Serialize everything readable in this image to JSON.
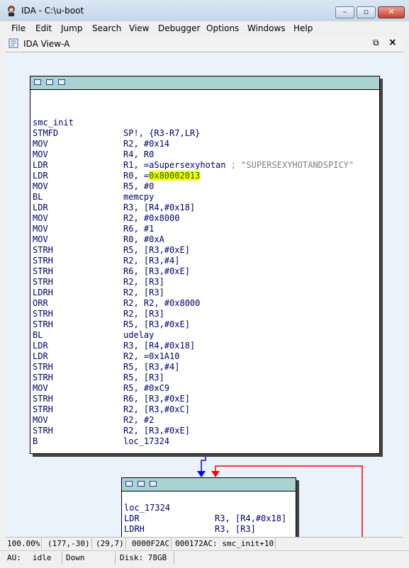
{
  "window": {
    "title": "IDA - C:\\u-boot",
    "min_label": "–",
    "max_label": "▫",
    "close_label": "✕"
  },
  "menu": [
    "File",
    "Edit",
    "Jump",
    "Search",
    "View",
    "Debugger",
    "Options",
    "Windows",
    "Help"
  ],
  "view_tab": {
    "title": "IDA View-A",
    "float_glyph": "⧉",
    "close_glyph": "×"
  },
  "graph": {
    "node1": {
      "label": "smc_init",
      "lines": [
        {
          "m": "STMFD",
          "o": "SP!, {R3-R7,LR}"
        },
        {
          "m": "MOV",
          "o": "R2, #0x14"
        },
        {
          "m": "MOV",
          "o": "R4, R0"
        },
        {
          "m": "LDR",
          "o": "R1, =aSupersexyhotan",
          "c": " ; \"SUPERSEXYHOTANDSPICY\""
        },
        {
          "m": "LDR",
          "o": "R0, =",
          "h": "0x80002013"
        },
        {
          "m": "MOV",
          "o": "R5, #0"
        },
        {
          "m": "BL",
          "o": "memcpy"
        },
        {
          "m": "LDR",
          "o": "R3, [R4,#0x18]"
        },
        {
          "m": "MOV",
          "o": "R2, #0x8000"
        },
        {
          "m": "MOV",
          "o": "R6, #1"
        },
        {
          "m": "MOV",
          "o": "R0, #0xA"
        },
        {
          "m": "STRH",
          "o": "R5, [R3,#0xE]"
        },
        {
          "m": "STRH",
          "o": "R2, [R3,#4]"
        },
        {
          "m": "STRH",
          "o": "R6, [R3,#0xE]"
        },
        {
          "m": "STRH",
          "o": "R2, [R3]"
        },
        {
          "m": "LDRH",
          "o": "R2, [R3]"
        },
        {
          "m": "ORR",
          "o": "R2, R2, #0x8000"
        },
        {
          "m": "STRH",
          "o": "R2, [R3]"
        },
        {
          "m": "STRH",
          "o": "R5, [R3,#0xE]"
        },
        {
          "m": "BL",
          "o": "udelay"
        },
        {
          "m": "LDR",
          "o": "R3, [R4,#0x18]"
        },
        {
          "m": "LDR",
          "o": "R2, =0x1A10"
        },
        {
          "m": "STRH",
          "o": "R5, [R3,#4]"
        },
        {
          "m": "STRH",
          "o": "R5, [R3]"
        },
        {
          "m": "MOV",
          "o": "R5, #0xC9"
        },
        {
          "m": "STRH",
          "o": "R6, [R3,#0xE]"
        },
        {
          "m": "STRH",
          "o": "R2, [R3,#0xC]"
        },
        {
          "m": "MOV",
          "o": "R2, #2"
        },
        {
          "m": "STRH",
          "o": "R2, [R3,#0xE]"
        },
        {
          "m": "B",
          "o": "loc_17324"
        }
      ]
    },
    "node2": {
      "label": "loc_17324",
      "lines": [
        {
          "m": "LDR",
          "o": "R3, [R4,#0x18]"
        },
        {
          "m": "LDRH",
          "o": "R3, [R3]"
        }
      ]
    },
    "colors": {
      "edge_true": "#0000ff",
      "edge_back": "#ff0000",
      "node_header": "#a9d3d1",
      "background": "#eaf3fb"
    }
  },
  "status1": [
    "100.00%",
    "(177,-30)",
    "(29,7)",
    "0000F2AC",
    "000172AC: smc_init+10"
  ],
  "status2": {
    "au": "AU:",
    "state": "idle",
    "direction": "Down",
    "disk": "Disk: 78GB"
  }
}
